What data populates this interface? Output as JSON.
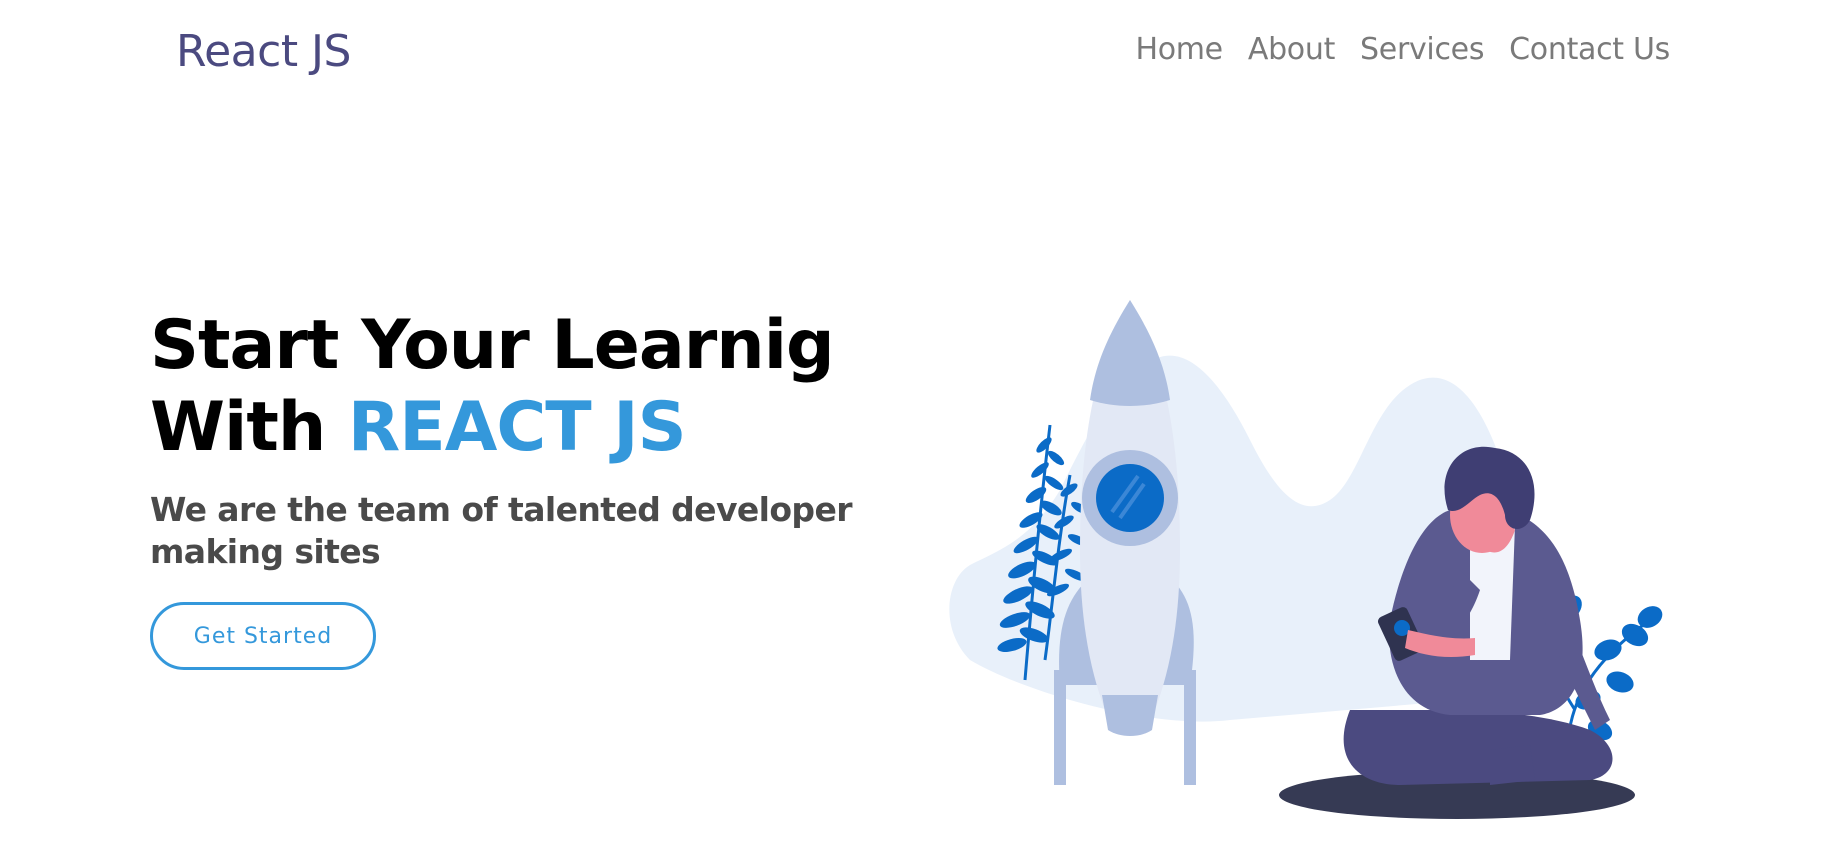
{
  "brand": {
    "name": "React JS"
  },
  "nav": {
    "items": [
      {
        "label": "Home"
      },
      {
        "label": "About"
      },
      {
        "label": "Services"
      },
      {
        "label": "Contact Us"
      }
    ]
  },
  "hero": {
    "headline_line1": "Start Your Learnig",
    "headline_prefix": "With ",
    "headline_highlight": "REACT JS",
    "tagline": "We are the team of talented developer making sites",
    "cta_label": "Get Started"
  },
  "colors": {
    "brand": "#4b4a80",
    "accent": "#3498db",
    "nav_text": "#7a7a7a"
  },
  "illustration": {
    "icon": "rocket-with-person-illustration"
  }
}
